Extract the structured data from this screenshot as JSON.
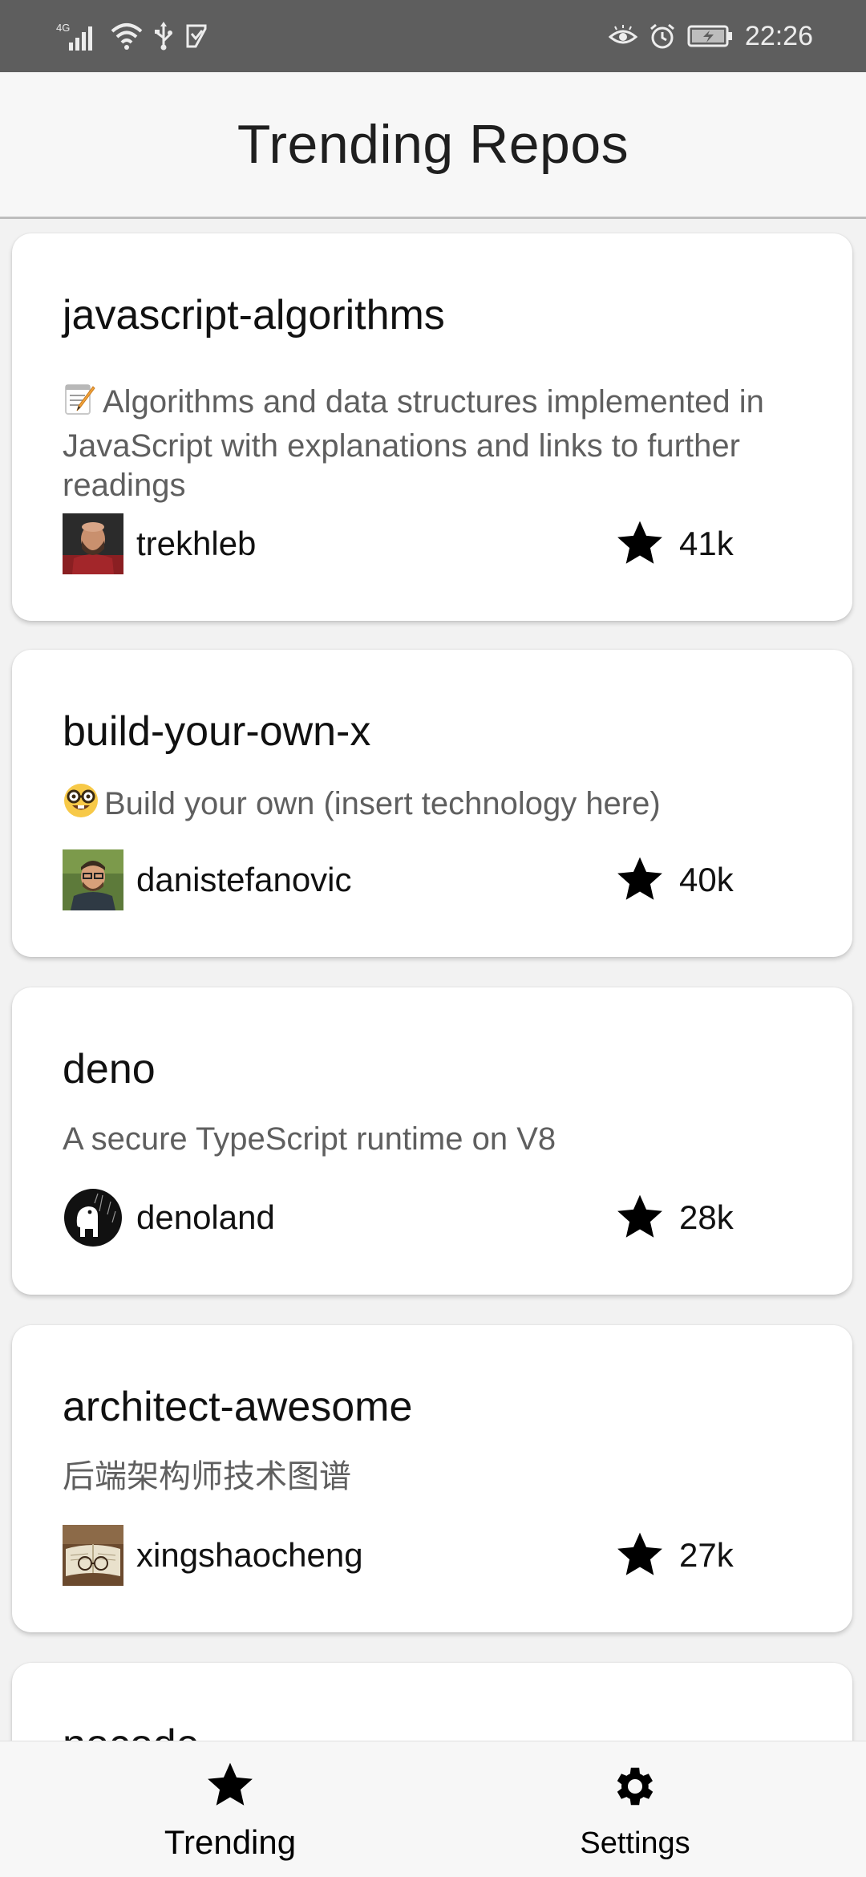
{
  "status_bar": {
    "network_label": "4G",
    "time": "22:26"
  },
  "header": {
    "title": "Trending Repos"
  },
  "repos": [
    {
      "name": "javascript-algorithms",
      "description_emoji": "memo-emoji",
      "description": "Algorithms and data structures implemented in JavaScript with explanations and links to further readings",
      "owner": "trekhleb",
      "stars": "41k"
    },
    {
      "name": "build-your-own-x",
      "description_emoji": "nerd-face-emoji",
      "description": "Build your own (insert technology here)",
      "owner": "danistefanovic",
      "stars": "40k"
    },
    {
      "name": "deno",
      "description": "A secure TypeScript runtime on V8",
      "owner": "denoland",
      "stars": "28k"
    },
    {
      "name": "architect-awesome",
      "description": "后端架构师技术图谱",
      "owner": "xingshaocheng",
      "stars": "27k"
    },
    {
      "name": "nocode"
    }
  ],
  "bottom_nav": {
    "items": [
      {
        "label": "Trending",
        "icon": "star-icon",
        "active": true
      },
      {
        "label": "Settings",
        "icon": "gear-icon",
        "active": false
      }
    ]
  },
  "colors": {
    "status_bar": "#5e5e5e",
    "header_bg": "#f7f7f7",
    "card_bg": "#ffffff",
    "text_primary": "#111111",
    "text_secondary": "#5f5f5f"
  }
}
